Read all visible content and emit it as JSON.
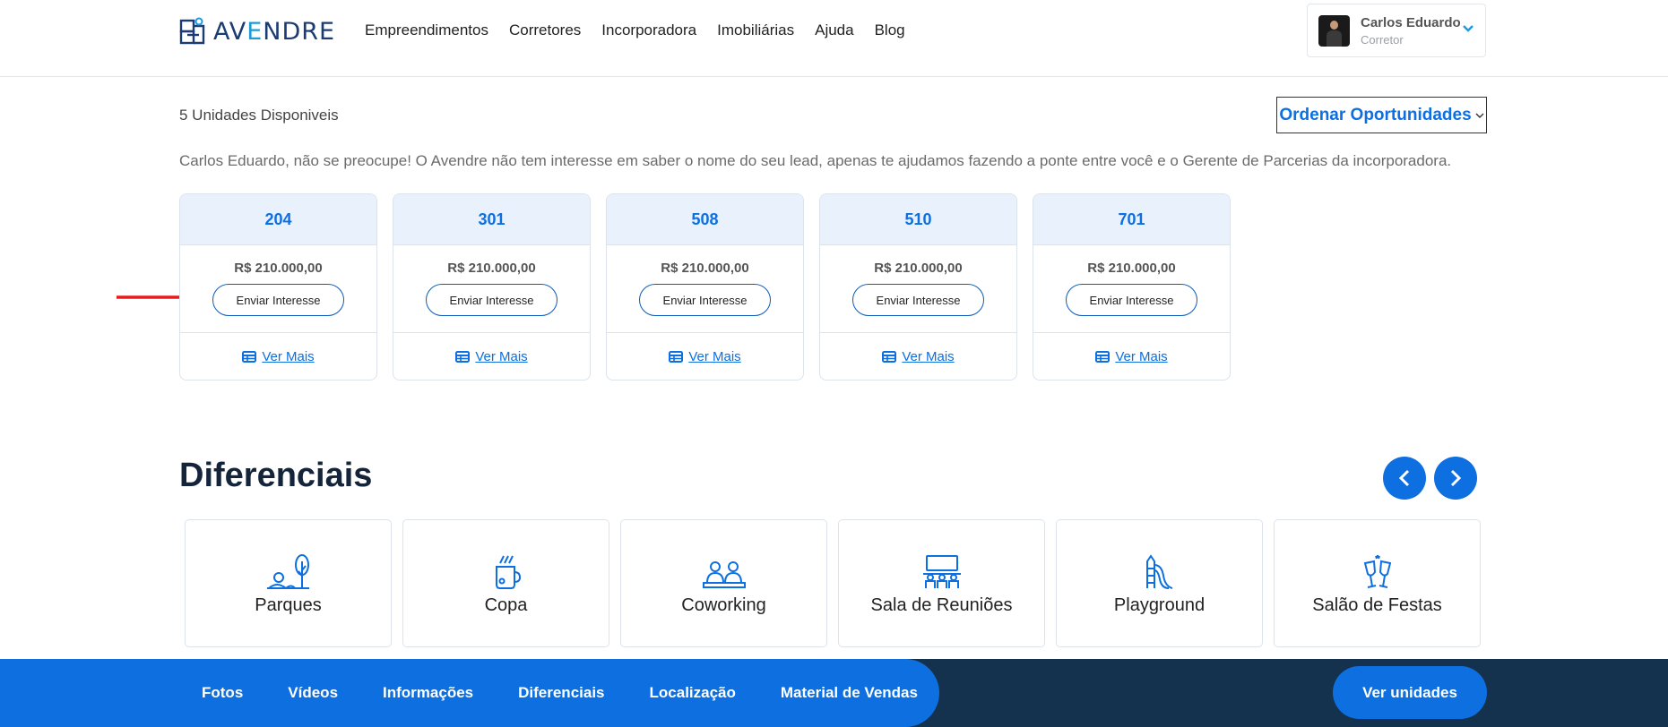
{
  "header": {
    "logo_text_a": "AV",
    "logo_text_b": "E",
    "logo_text_c": "NDRE",
    "nav": [
      "Empreendimentos",
      "Corretores",
      "Incorporadora",
      "Imobiliárias",
      "Ajuda",
      "Blog"
    ],
    "user": {
      "name": "Carlos Eduardo",
      "role": "Corretor"
    }
  },
  "units": {
    "count_label": "5 Unidades Disponiveis",
    "sort_label": "Ordenar Oportunidades",
    "notice": "Carlos Eduardo, não se preocupe! O Avendre não tem interesse em saber o nome do seu lead, apenas te ajudamos fazendo a ponte entre você e o Gerente de Parcerias da incorporadora.",
    "cards": [
      {
        "number": "204",
        "price": "R$ 210.000,00",
        "button": "Enviar Interesse",
        "link": "Ver Mais"
      },
      {
        "number": "301",
        "price": "R$ 210.000,00",
        "button": "Enviar Interesse",
        "link": "Ver Mais"
      },
      {
        "number": "508",
        "price": "R$ 210.000,00",
        "button": "Enviar Interesse",
        "link": "Ver Mais"
      },
      {
        "number": "510",
        "price": "R$ 210.000,00",
        "button": "Enviar Interesse",
        "link": "Ver Mais"
      },
      {
        "number": "701",
        "price": "R$ 210.000,00",
        "button": "Enviar Interesse",
        "link": "Ver Mais"
      }
    ]
  },
  "diferenciais": {
    "title": "Diferenciais",
    "items": [
      {
        "label": "Parques",
        "icon": "park-icon"
      },
      {
        "label": "Copa",
        "icon": "coffee-cup-icon"
      },
      {
        "label": "Coworking",
        "icon": "coworking-icon"
      },
      {
        "label": "Sala de Reuniões",
        "icon": "meeting-room-icon"
      },
      {
        "label": "Playground",
        "icon": "playground-slide-icon"
      },
      {
        "label": "Salão de Festas",
        "icon": "toast-glasses-icon"
      }
    ]
  },
  "bottom_nav": {
    "links": [
      "Fotos",
      "Vídeos",
      "Informações",
      "Diferenciais",
      "Localização",
      "Material de Vendas"
    ],
    "cta": "Ver unidades"
  },
  "colors": {
    "primary": "#0d6fe0",
    "dark": "#14324d",
    "card_header_bg": "#e8f1fc",
    "arrow": "#e81b1b"
  }
}
